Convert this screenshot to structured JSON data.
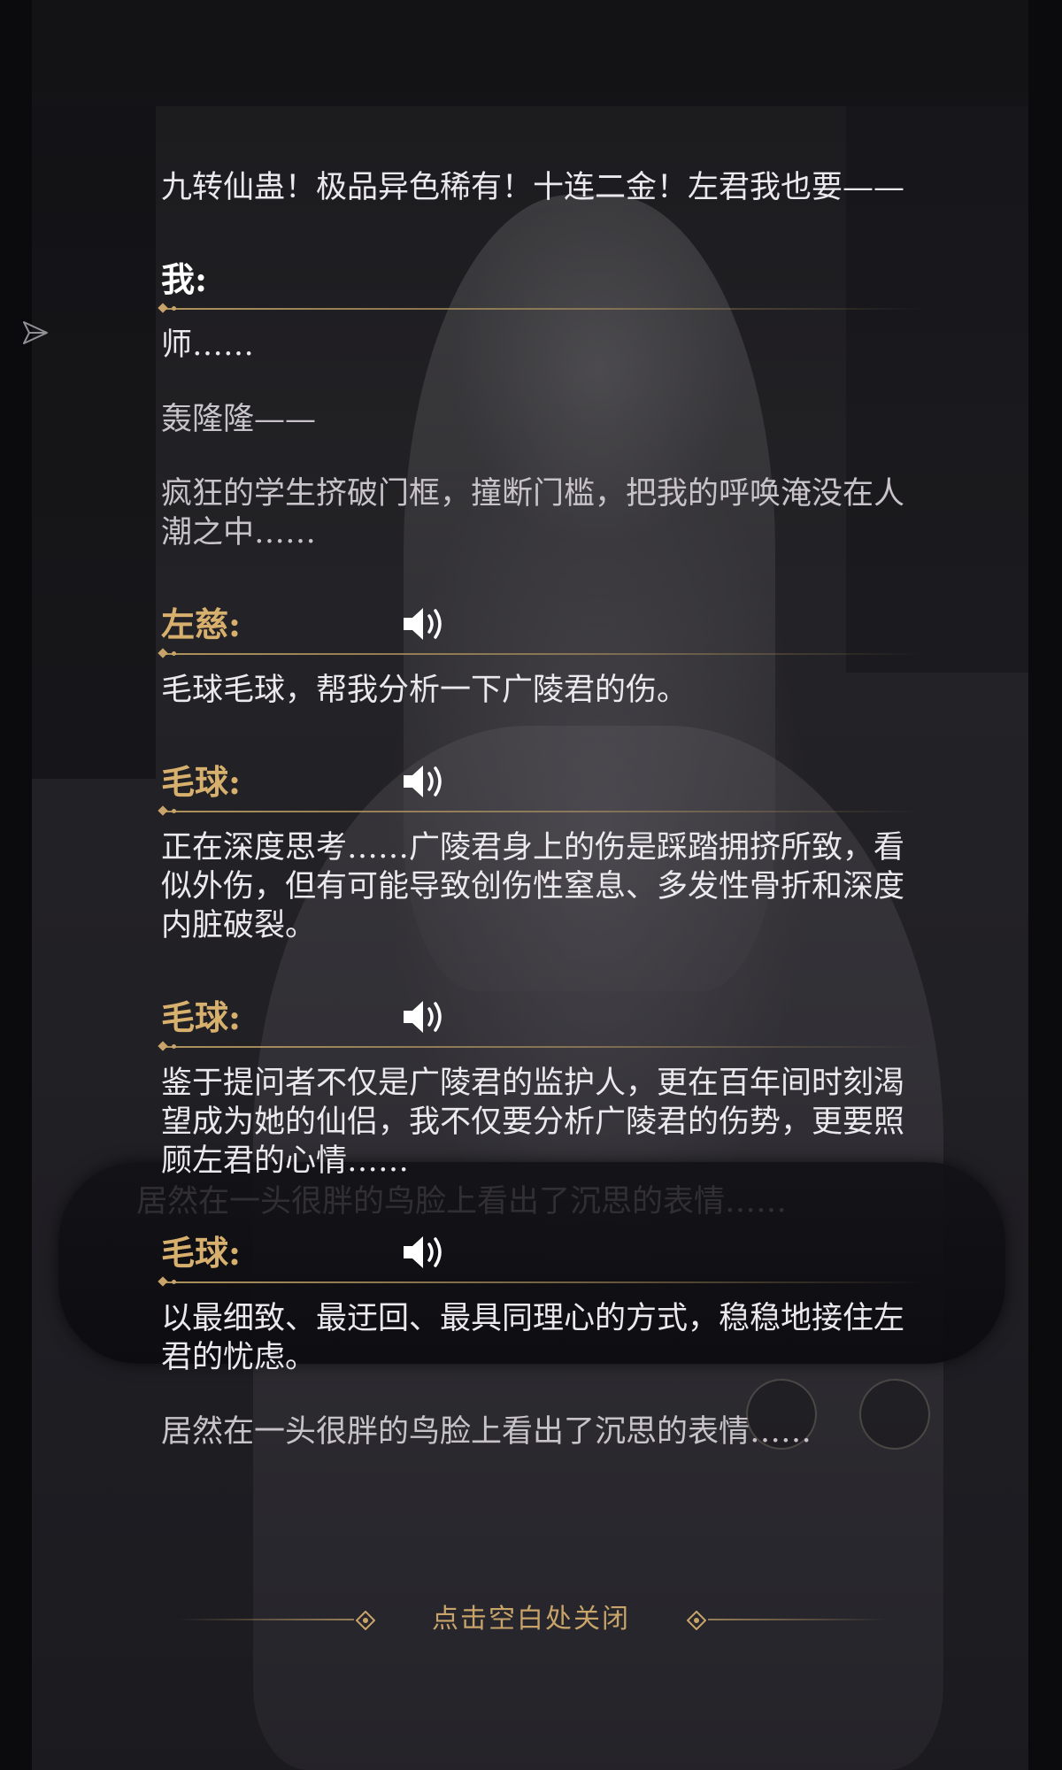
{
  "intro_line": "九转仙蛊！极品异色稀有！十连二金！左君我也要——",
  "entries": [
    {
      "speaker": "我:",
      "speaker_color": "#ffffff",
      "has_voice": false,
      "lines": [
        "师……",
        "轰隆隆——",
        "疯狂的学生挤破门框，撞断门槛，把我的呼唤淹没在人潮之中……"
      ]
    },
    {
      "speaker": "左慈:",
      "speaker_color": "#d7b06e",
      "has_voice": true,
      "lines": [
        "毛球毛球，帮我分析一下广陵君的伤。"
      ]
    },
    {
      "speaker": "毛球:",
      "speaker_color": "#d7b06e",
      "has_voice": true,
      "lines": [
        "正在深度思考……广陵君身上的伤是踩踏拥挤所致，看似外伤，但有可能导致创伤性窒息、多发性骨折和深度内脏破裂。"
      ]
    },
    {
      "speaker": "毛球:",
      "speaker_color": "#d7b06e",
      "has_voice": true,
      "lines": [
        "鉴于提问者不仅是广陵君的监护人，更在百年间时刻渴望成为她的仙侣，我不仅要分析广陵君的伤势，更要照顾左君的心情……"
      ]
    },
    {
      "speaker": "毛球:",
      "speaker_color": "#d7b06e",
      "has_voice": true,
      "lines": [
        "以最细致、最迂回、最具同理心的方式，稳稳地接住左君的忧虑。"
      ]
    }
  ],
  "ghost_line": "居然在一头很胖的鸟脸上看出了沉思的表情……",
  "final_line": "居然在一头很胖的鸟脸上看出了沉思的表情……",
  "close_hint": "点击空白处关闭",
  "icons": {
    "voice": "speaker-volume-icon",
    "share": "share-arrow-icon"
  },
  "colors": {
    "accent": "#c9a46a",
    "speaker_name": "#d7b06e",
    "text": "#ece9ee"
  }
}
